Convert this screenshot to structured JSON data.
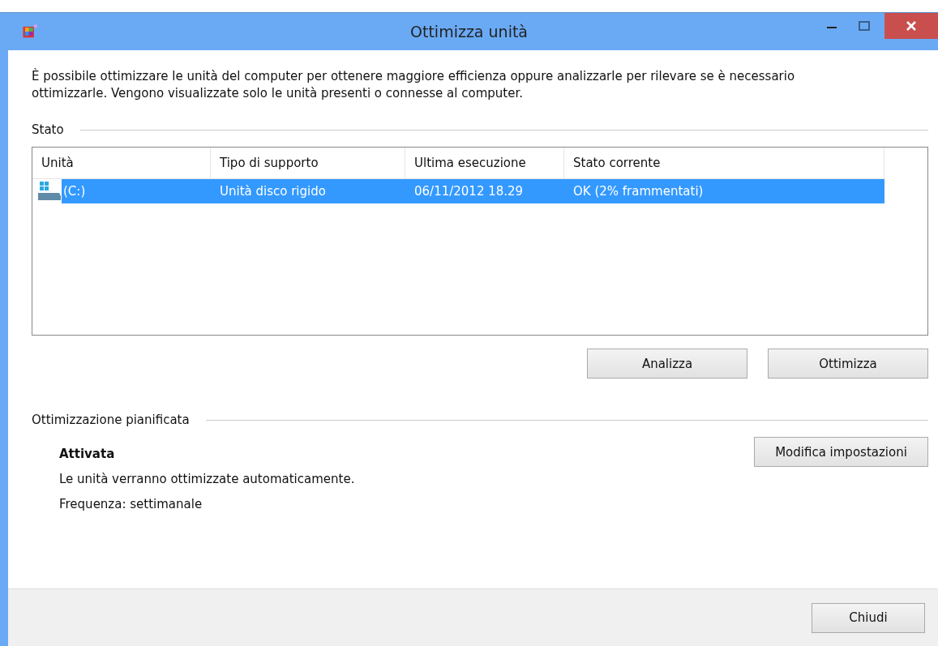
{
  "window": {
    "title": "Ottimizza unità"
  },
  "intro": "È possibile ottimizzare le unità del computer per ottenere maggiore efficienza oppure analizzarle per rilevare se è necessario ottimizzarle. Vengono visualizzate solo le unità presenti o connesse al computer.",
  "status_section": {
    "heading": "Stato"
  },
  "table": {
    "columns": [
      "Unità",
      "Tipo di supporto",
      "Ultima esecuzione",
      "Stato corrente"
    ],
    "rows": [
      {
        "cells": [
          "(C:)",
          "Unità disco rigido",
          "06/11/2012 18.29",
          "OK (2% frammentati)"
        ],
        "selected": true
      }
    ]
  },
  "actions": [
    "Analizza",
    "Ottimizza"
  ],
  "schedule": {
    "heading": "Ottimizzazione pianificata",
    "status": "Attivata",
    "description": "Le unità verranno ottimizzate automaticamente.",
    "frequency": "Frequenza: settimanale",
    "button": "Modifica impostazioni"
  },
  "footer": {
    "button": "Chiudi"
  }
}
